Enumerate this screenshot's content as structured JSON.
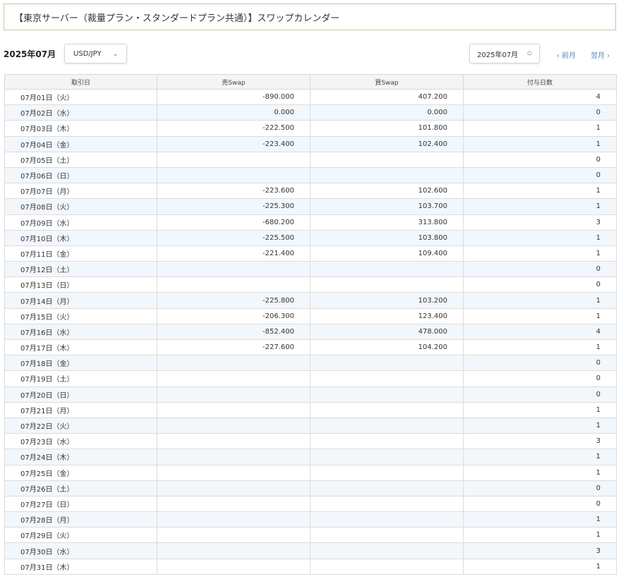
{
  "header": {
    "title": "【東京サーバー（裁量プラン・スタンダードプラン共通）】スワップカレンダー"
  },
  "toolbar": {
    "month_label": "2025年07月",
    "currency": "USD/JPY",
    "month_select": "2025年07月",
    "prev_label": "‹  前月",
    "next_label": "翌月  ›"
  },
  "table": {
    "columns": [
      "取引日",
      "売Swap",
      "買Swap",
      "付与日数"
    ],
    "rows": [
      {
        "date": "07月01日（火）",
        "sell": "-890.000",
        "buy": "407.200",
        "days": "4"
      },
      {
        "date": "07月02日（水）",
        "sell": "0.000",
        "buy": "0.000",
        "days": "0"
      },
      {
        "date": "07月03日（木）",
        "sell": "-222.500",
        "buy": "101.800",
        "days": "1"
      },
      {
        "date": "07月04日（金）",
        "sell": "-223.400",
        "buy": "102.400",
        "days": "1"
      },
      {
        "date": "07月05日（土）",
        "sell": "",
        "buy": "",
        "days": "0"
      },
      {
        "date": "07月06日（日）",
        "sell": "",
        "buy": "",
        "days": "0"
      },
      {
        "date": "07月07日（月）",
        "sell": "-223.600",
        "buy": "102.600",
        "days": "1"
      },
      {
        "date": "07月08日（火）",
        "sell": "-225.300",
        "buy": "103.700",
        "days": "1"
      },
      {
        "date": "07月09日（水）",
        "sell": "-680.200",
        "buy": "313.800",
        "days": "3"
      },
      {
        "date": "07月10日（木）",
        "sell": "-225.500",
        "buy": "103.800",
        "days": "1"
      },
      {
        "date": "07月11日（金）",
        "sell": "-221.400",
        "buy": "109.400",
        "days": "1"
      },
      {
        "date": "07月12日（土）",
        "sell": "",
        "buy": "",
        "days": "0"
      },
      {
        "date": "07月13日（日）",
        "sell": "",
        "buy": "",
        "days": "0"
      },
      {
        "date": "07月14日（月）",
        "sell": "-225.800",
        "buy": "103.200",
        "days": "1"
      },
      {
        "date": "07月15日（火）",
        "sell": "-206.300",
        "buy": "123.400",
        "days": "1"
      },
      {
        "date": "07月16日（水）",
        "sell": "-852.400",
        "buy": "478.000",
        "days": "4"
      },
      {
        "date": "07月17日（木）",
        "sell": "-227.600",
        "buy": "104.200",
        "days": "1"
      },
      {
        "date": "07月18日（金）",
        "sell": "",
        "buy": "",
        "days": "0"
      },
      {
        "date": "07月19日（土）",
        "sell": "",
        "buy": "",
        "days": "0"
      },
      {
        "date": "07月20日（日）",
        "sell": "",
        "buy": "",
        "days": "0"
      },
      {
        "date": "07月21日（月）",
        "sell": "",
        "buy": "",
        "days": "1"
      },
      {
        "date": "07月22日（火）",
        "sell": "",
        "buy": "",
        "days": "1"
      },
      {
        "date": "07月23日（水）",
        "sell": "",
        "buy": "",
        "days": "3"
      },
      {
        "date": "07月24日（木）",
        "sell": "",
        "buy": "",
        "days": "1"
      },
      {
        "date": "07月25日（金）",
        "sell": "",
        "buy": "",
        "days": "1"
      },
      {
        "date": "07月26日（土）",
        "sell": "",
        "buy": "",
        "days": "0"
      },
      {
        "date": "07月27日（日）",
        "sell": "",
        "buy": "",
        "days": "0"
      },
      {
        "date": "07月28日（月）",
        "sell": "",
        "buy": "",
        "days": "1"
      },
      {
        "date": "07月29日（火）",
        "sell": "",
        "buy": "",
        "days": "1"
      },
      {
        "date": "07月30日（水）",
        "sell": "",
        "buy": "",
        "days": "3"
      },
      {
        "date": "07月31日（木）",
        "sell": "",
        "buy": "",
        "days": "1"
      }
    ]
  },
  "icons": {
    "currency_chevron": "chevron-down-icon",
    "month_updown": "updown-arrows-icon"
  },
  "colors": {
    "row_alt": "#f2f7fc",
    "nav_link": "#5a88b8",
    "title_border": "#c8c8a4"
  }
}
